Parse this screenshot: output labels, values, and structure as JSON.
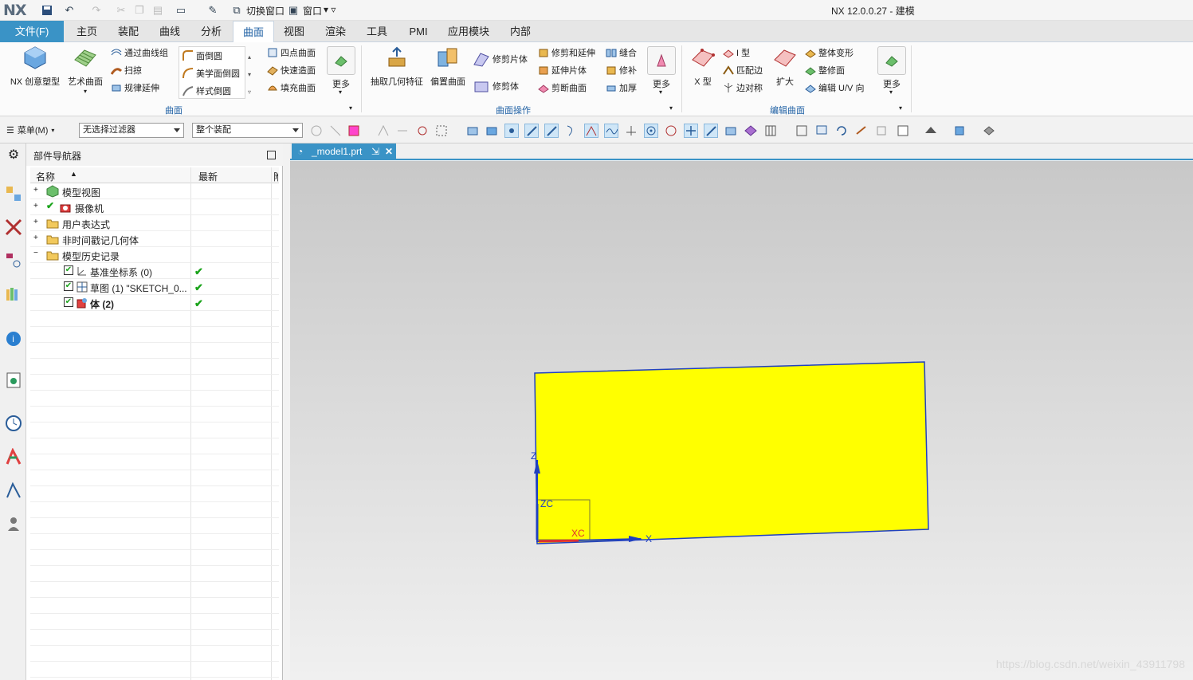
{
  "titlebar": {
    "logo": "NX",
    "switch_window": "切换窗口",
    "window_menu": "窗口",
    "app_title": "NX 12.0.0.27 - 建模"
  },
  "menubar": {
    "file": "文件(F)",
    "tabs": [
      "主页",
      "装配",
      "曲线",
      "分析",
      "曲面",
      "视图",
      "渲染",
      "工具",
      "PMI",
      "应用模块",
      "内部"
    ],
    "active": "曲面"
  },
  "ribbon": {
    "surface_group": {
      "label": "曲面",
      "nx_creative": "NX 创意塑型",
      "art_surface": "艺术曲面",
      "through_curves": "通过曲线组",
      "sweep": "扫掠",
      "law_extension": "规律延伸",
      "face_blend": "面倒圆",
      "aesthetic_blend": "美学面倒圆",
      "styled_blend": "样式倒圆",
      "four_point": "四点曲面",
      "rapid_surfacing": "快速造面",
      "fill_surface": "填充曲面",
      "more": "更多"
    },
    "surface_ops_group": {
      "label": "曲面操作",
      "extract": "抽取几何特征",
      "offset": "偏置曲面",
      "trim_sheet": "修剪片体",
      "trimmed_body": "修剪体",
      "trim_extend": "修剪和延伸",
      "extend_sheet": "延伸片体",
      "cut_surface": "剪断曲面",
      "sew": "缝合",
      "patch": "修补",
      "thicken": "加厚",
      "more": "更多"
    },
    "edit_surface_group": {
      "label": "编辑曲面",
      "x_form": "X 型",
      "i_form": "I 型",
      "match_edge": "匹配边",
      "edge_symmetry": "边对称",
      "enlarge": "扩大",
      "global_shaping": "整体变形",
      "refit": "整修面",
      "edit_uv": "编辑 U/V 向",
      "more": "更多"
    }
  },
  "toolbar2": {
    "menu": "菜单(M)",
    "filter": "无选择过滤器",
    "scope": "整个装配"
  },
  "navigator": {
    "title": "部件导航器",
    "col_name": "名称",
    "col_latest": "最新",
    "col_extra": "附",
    "items": [
      {
        "label": "模型视图",
        "latest": ""
      },
      {
        "label": "摄像机",
        "latest": ""
      },
      {
        "label": "用户表达式",
        "latest": ""
      },
      {
        "label": "非时间戳记几何体",
        "latest": ""
      },
      {
        "label": "模型历史记录",
        "latest": ""
      },
      {
        "label": "基准坐标系 (0)",
        "latest": "✔"
      },
      {
        "label": "草图 (1) \"SKETCH_0...",
        "latest": "✔"
      },
      {
        "label": "体 (2)",
        "latest": "✔"
      }
    ]
  },
  "viewport": {
    "doc_tab": "_model1.prt",
    "axis_z": "Z",
    "axis_zc": "ZC",
    "axis_xc": "XC",
    "axis_x": "X",
    "sheet_color": "#ffff00",
    "edge_color": "#2040c0"
  },
  "watermark": "https://blog.csdn.net/weixin_43911798"
}
